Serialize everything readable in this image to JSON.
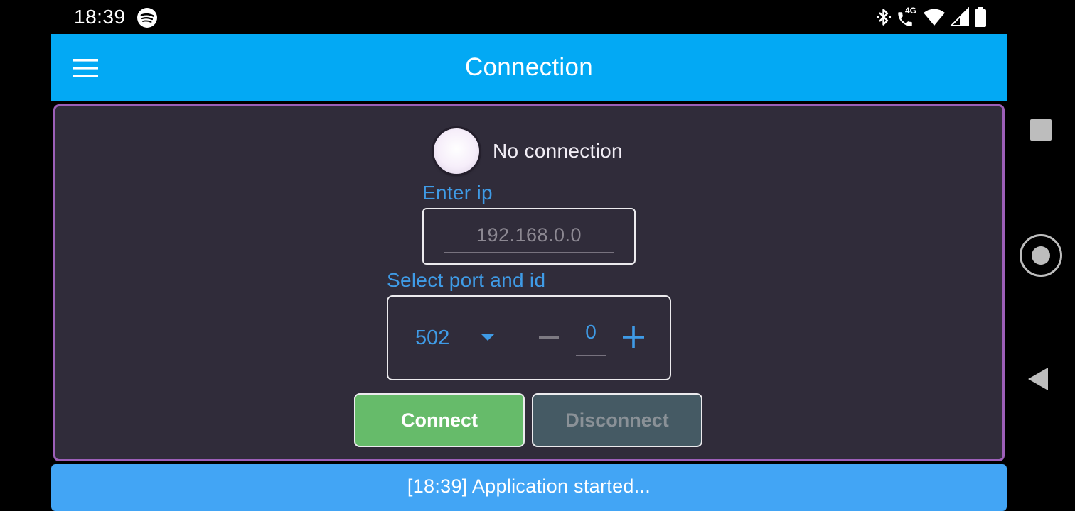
{
  "status_bar": {
    "time": "18:39",
    "network_label": "4G",
    "icons": [
      "spotify-icon",
      "bluetooth-icon",
      "phone-4g-icon",
      "wifi-icon",
      "signal-icon",
      "battery-icon"
    ]
  },
  "app_bar": {
    "title": "Connection",
    "menu_icon": "hamburger-menu-icon",
    "color": "#03a9f4"
  },
  "connection": {
    "status_text": "No connection",
    "ip_label": "Enter ip",
    "ip_value": "",
    "ip_placeholder": "192.168.0.0",
    "port_label": "Select port and id",
    "port_value": "502",
    "id_value": "0",
    "stepper_minus": "−",
    "stepper_plus": "+"
  },
  "buttons": {
    "connect_label": "Connect",
    "disconnect_label": "Disconnect",
    "connect_color": "#66bb6a",
    "disconnect_color": "#455a64"
  },
  "log": {
    "message": "[18:39] Application started..."
  },
  "colors": {
    "panel_bg": "#302c3a",
    "panel_border": "#9c5fb8",
    "accent_blue": "#3f9be6",
    "log_bar": "#42a5f5"
  }
}
